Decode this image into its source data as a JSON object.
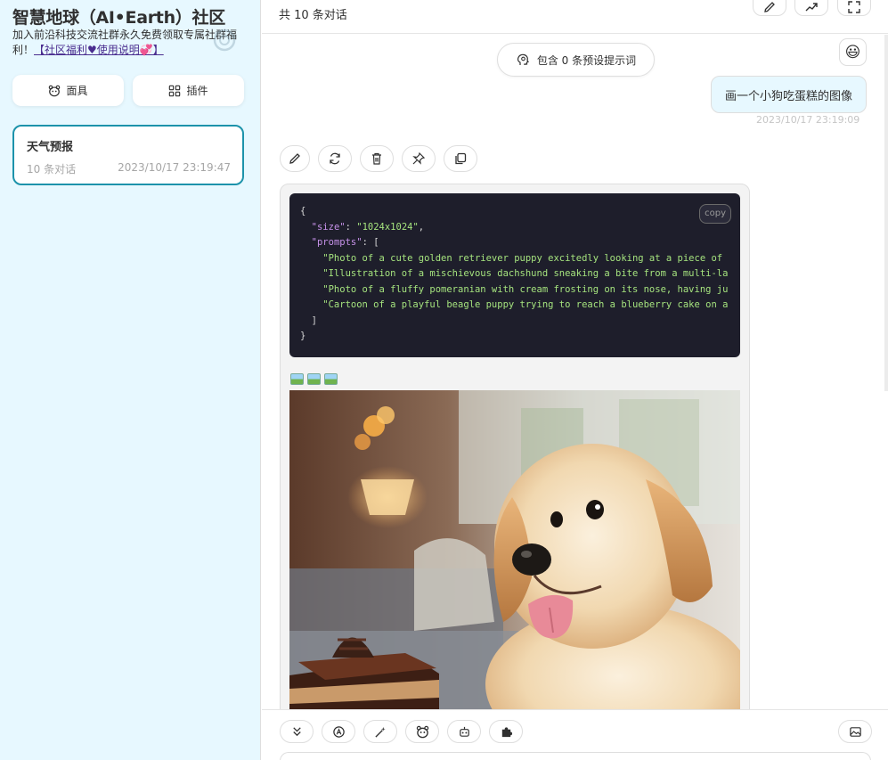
{
  "sidebar": {
    "title": "智慧地球（AI•Earth）社区",
    "subtitle": "加入前沿科技交流社群永久免费领取专属社群福利！",
    "subtitle_link": "【社区福利♥使用说明💞】",
    "buttons": {
      "mask_label": "面具",
      "plugin_label": "插件"
    },
    "chats": [
      {
        "title": "天气预报",
        "count": "10 条对话",
        "time": "2023/10/17 23:19:47"
      }
    ]
  },
  "header": {
    "subtitle": "共 10 条对话"
  },
  "chat": {
    "prompt_pill": "包含 0 条预设提示词",
    "user_avatar": "😃",
    "user_message": "画一个小狗吃蛋糕的图像",
    "user_time": "2023/10/17 23:19:09",
    "code": {
      "copy_label": "copy",
      "lines": [
        "{",
        "  \"size\": \"1024x1024\",",
        "  \"prompts\": [",
        "    \"Photo of a cute golden retriever puppy excitedly looking at a piece of",
        "    \"Illustration of a mischievous dachshund sneaking a bite from a multi-la",
        "    \"Photo of a fluffy pomeranian with cream frosting on its nose, having ju",
        "    \"Cartoon of a playful beagle puppy trying to reach a blueberry cake on a",
        "  ]",
        "}"
      ]
    }
  },
  "colors": {
    "sidebar_bg": "#e7f8ff",
    "accent": "#1d93ab",
    "code_bg": "#1e1e2b"
  }
}
